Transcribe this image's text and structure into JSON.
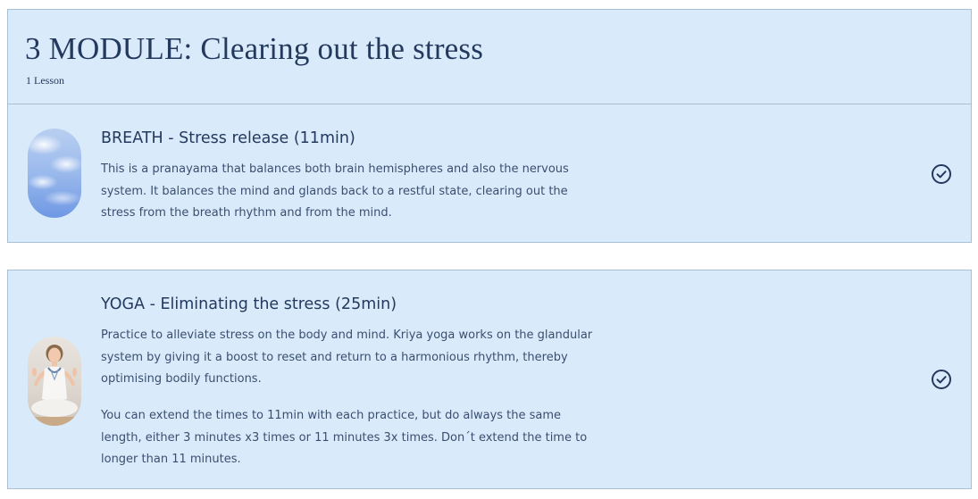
{
  "module": {
    "title": "3 MODULE: Clearing out the stress",
    "lesson_count": "1 Lesson"
  },
  "lessons": [
    {
      "title": "BREATH - Stress release (11min)",
      "description": [
        "This is a pranayama that balances both brain hemispheres and also the nervous system. It balances the mind and glands back to a restful state, clearing out the stress from the breath rhythm and from the mind."
      ],
      "thumbnail_icon": "sky-clouds-image",
      "status_icon": "check-circle-icon"
    },
    {
      "title": "YOGA - Eliminating the stress (25min)",
      "description": [
        "Practice to alleviate stress on the body and mind. Kriya yoga works on the glandular system by giving it a boost to reset and return to a harmonious rhythm, thereby optimising bodily functions.",
        "You can extend the times to 11min with each practice, but do always the same length, either 3 minutes x3 times or 11 minutes 3x times. Don´t extend the time to longer than 11 minutes."
      ],
      "thumbnail_icon": "yoga-meditation-image",
      "status_icon": "check-circle-icon"
    }
  ],
  "colors": {
    "card_background": "#d9ebfa",
    "card_border": "#a9bfd3",
    "heading_text": "#23395d",
    "body_text": "#3a4f70"
  }
}
